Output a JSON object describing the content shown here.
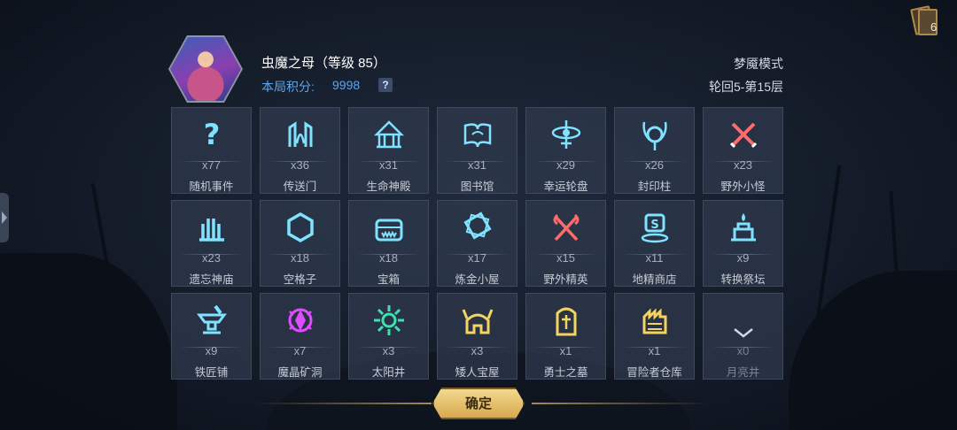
{
  "hero": {
    "name": "虫魔之母（等级 85）",
    "score_label": "本局积分:",
    "score_value": "9998",
    "help_label": "?"
  },
  "mode": {
    "name": "梦魇模式",
    "round": "轮回5-第15层"
  },
  "deck": {
    "count": "6"
  },
  "cells": [
    {
      "label": "随机事件",
      "count": "x77",
      "icon": "question-icon",
      "color": "#7fe3ff"
    },
    {
      "label": "传送门",
      "count": "x36",
      "icon": "portal-icon",
      "color": "#7fe3ff"
    },
    {
      "label": "生命神殿",
      "count": "x31",
      "icon": "temple-icon",
      "color": "#7fe3ff"
    },
    {
      "label": "图书馆",
      "count": "x31",
      "icon": "book-icon",
      "color": "#7fe3ff"
    },
    {
      "label": "幸运轮盘",
      "count": "x29",
      "icon": "wheel-icon",
      "color": "#7fe3ff"
    },
    {
      "label": "封印柱",
      "count": "x26",
      "icon": "seal-icon",
      "color": "#7fe3ff"
    },
    {
      "label": "野外小怪",
      "count": "x23",
      "icon": "crossed-swords-icon",
      "color": "#ff6b6b"
    },
    {
      "label": "遗忘神庙",
      "count": "x23",
      "icon": "pillars-icon",
      "color": "#7fe3ff"
    },
    {
      "label": "空格子",
      "count": "x18",
      "icon": "hexagon-icon",
      "color": "#7fe3ff"
    },
    {
      "label": "宝箱",
      "count": "x18",
      "icon": "chest-icon",
      "color": "#7fe3ff"
    },
    {
      "label": "炼金小屋",
      "count": "x17",
      "icon": "alchemy-icon",
      "color": "#7fe3ff"
    },
    {
      "label": "野外精英",
      "count": "x15",
      "icon": "crossed-axes-icon",
      "color": "#ff6b6b"
    },
    {
      "label": "地精商店",
      "count": "x11",
      "icon": "shop-icon",
      "color": "#7fe3ff"
    },
    {
      "label": "转换祭坛",
      "count": "x9",
      "icon": "altar-icon",
      "color": "#7fe3ff"
    },
    {
      "label": "铁匠铺",
      "count": "x9",
      "icon": "anvil-icon",
      "color": "#7fe3ff"
    },
    {
      "label": "魔晶矿洞",
      "count": "x7",
      "icon": "crystal-mine-icon",
      "color": "#e04cff"
    },
    {
      "label": "太阳井",
      "count": "x3",
      "icon": "sun-icon",
      "color": "#3ee0b0"
    },
    {
      "label": "矮人宝屋",
      "count": "x3",
      "icon": "helmet-icon",
      "color": "#f4d35e"
    },
    {
      "label": "勇士之墓",
      "count": "x1",
      "icon": "tomb-icon",
      "color": "#f4d35e"
    },
    {
      "label": "冒险者仓库",
      "count": "x1",
      "icon": "warehouse-icon",
      "color": "#f4d35e"
    },
    {
      "label": "月亮井",
      "count": "x0",
      "icon": "moon-icon",
      "color": "#cfd6e3"
    }
  ],
  "confirm_label": "确定"
}
